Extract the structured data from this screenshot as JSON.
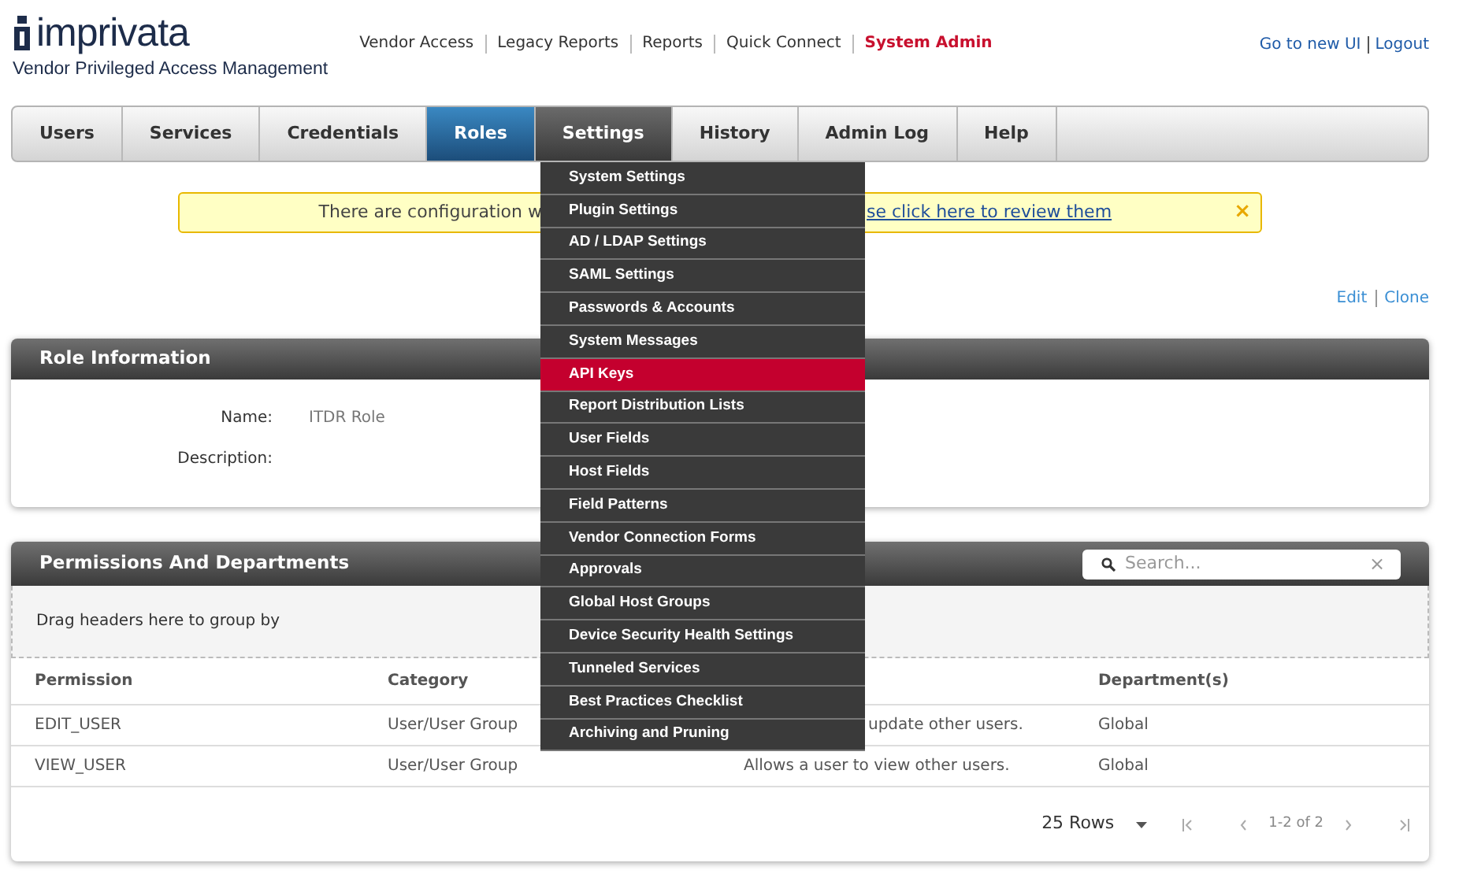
{
  "brand": {
    "wordmark": "imprivata",
    "subtitle": "Vendor Privileged Access Management"
  },
  "top_links": [
    {
      "label": "Vendor Access",
      "selected": false
    },
    {
      "label": "Legacy Reports",
      "selected": false
    },
    {
      "label": "Reports",
      "selected": false
    },
    {
      "label": "Quick Connect",
      "selected": false
    },
    {
      "label": "System Admin",
      "selected": true
    }
  ],
  "user_links": [
    "Go to new UI",
    "Logout"
  ],
  "tabs": [
    {
      "label": "Users",
      "selected": false,
      "expanded": false
    },
    {
      "label": "Services",
      "selected": false,
      "expanded": false
    },
    {
      "label": "Credentials",
      "selected": false,
      "expanded": false
    },
    {
      "label": "Roles",
      "selected": true,
      "expanded": false
    },
    {
      "label": "Settings",
      "selected": false,
      "expanded": true
    },
    {
      "label": "History",
      "selected": false,
      "expanded": false
    },
    {
      "label": "Admin Log",
      "selected": false,
      "expanded": false
    },
    {
      "label": "Help",
      "selected": false,
      "expanded": false
    }
  ],
  "settings_menu": [
    {
      "label": "System Settings",
      "selected": false
    },
    {
      "label": "Plugin Settings",
      "selected": false
    },
    {
      "label": "AD / LDAP Settings",
      "selected": false
    },
    {
      "label": "SAML Settings",
      "selected": false
    },
    {
      "label": "Passwords & Accounts",
      "selected": false
    },
    {
      "label": "System Messages",
      "selected": false
    },
    {
      "label": "API Keys",
      "selected": true
    },
    {
      "label": "Report Distribution Lists",
      "selected": false
    },
    {
      "label": "User Fields",
      "selected": false
    },
    {
      "label": "Host Fields",
      "selected": false
    },
    {
      "label": "Field Patterns",
      "selected": false
    },
    {
      "label": "Vendor Connection Forms",
      "selected": false
    },
    {
      "label": "Approvals",
      "selected": false
    },
    {
      "label": "Global Host Groups",
      "selected": false
    },
    {
      "label": "Device Security Health Settings",
      "selected": false
    },
    {
      "label": "Tunneled Services",
      "selected": false
    },
    {
      "label": "Best Practices Checklist",
      "selected": false
    },
    {
      "label": "Archiving and Pruning",
      "selected": false
    }
  ],
  "alert": {
    "text": "There are configuration w",
    "link": "se click here to review them",
    "close": "×"
  },
  "actions": [
    "Edit",
    "Clone"
  ],
  "role_info": {
    "title": "Role Information",
    "fields": [
      {
        "label": "Name:",
        "value": "ITDR Role"
      },
      {
        "label": "Description:"
      }
    ]
  },
  "permissions": {
    "title": "Permissions And Departments",
    "search": {
      "placeholder": "Search...",
      "clear": "×"
    },
    "group_hint": "Drag headers here to group by",
    "column_headers": {
      "permission": "Permission",
      "category": "Category",
      "department": "Department(s)"
    },
    "rows": [
      {
        "permission": "EDIT_USER",
        "category": "User/User Group",
        "column_3": "update other users.",
        "department": "Global"
      },
      {
        "permission": "VIEW_USER",
        "category": "User/User Group",
        "column_3": "Allows a user to view other users.",
        "department": "Global"
      }
    ],
    "pager": {
      "page_size": "25 Rows",
      "range": "1-2 of 2"
    }
  }
}
